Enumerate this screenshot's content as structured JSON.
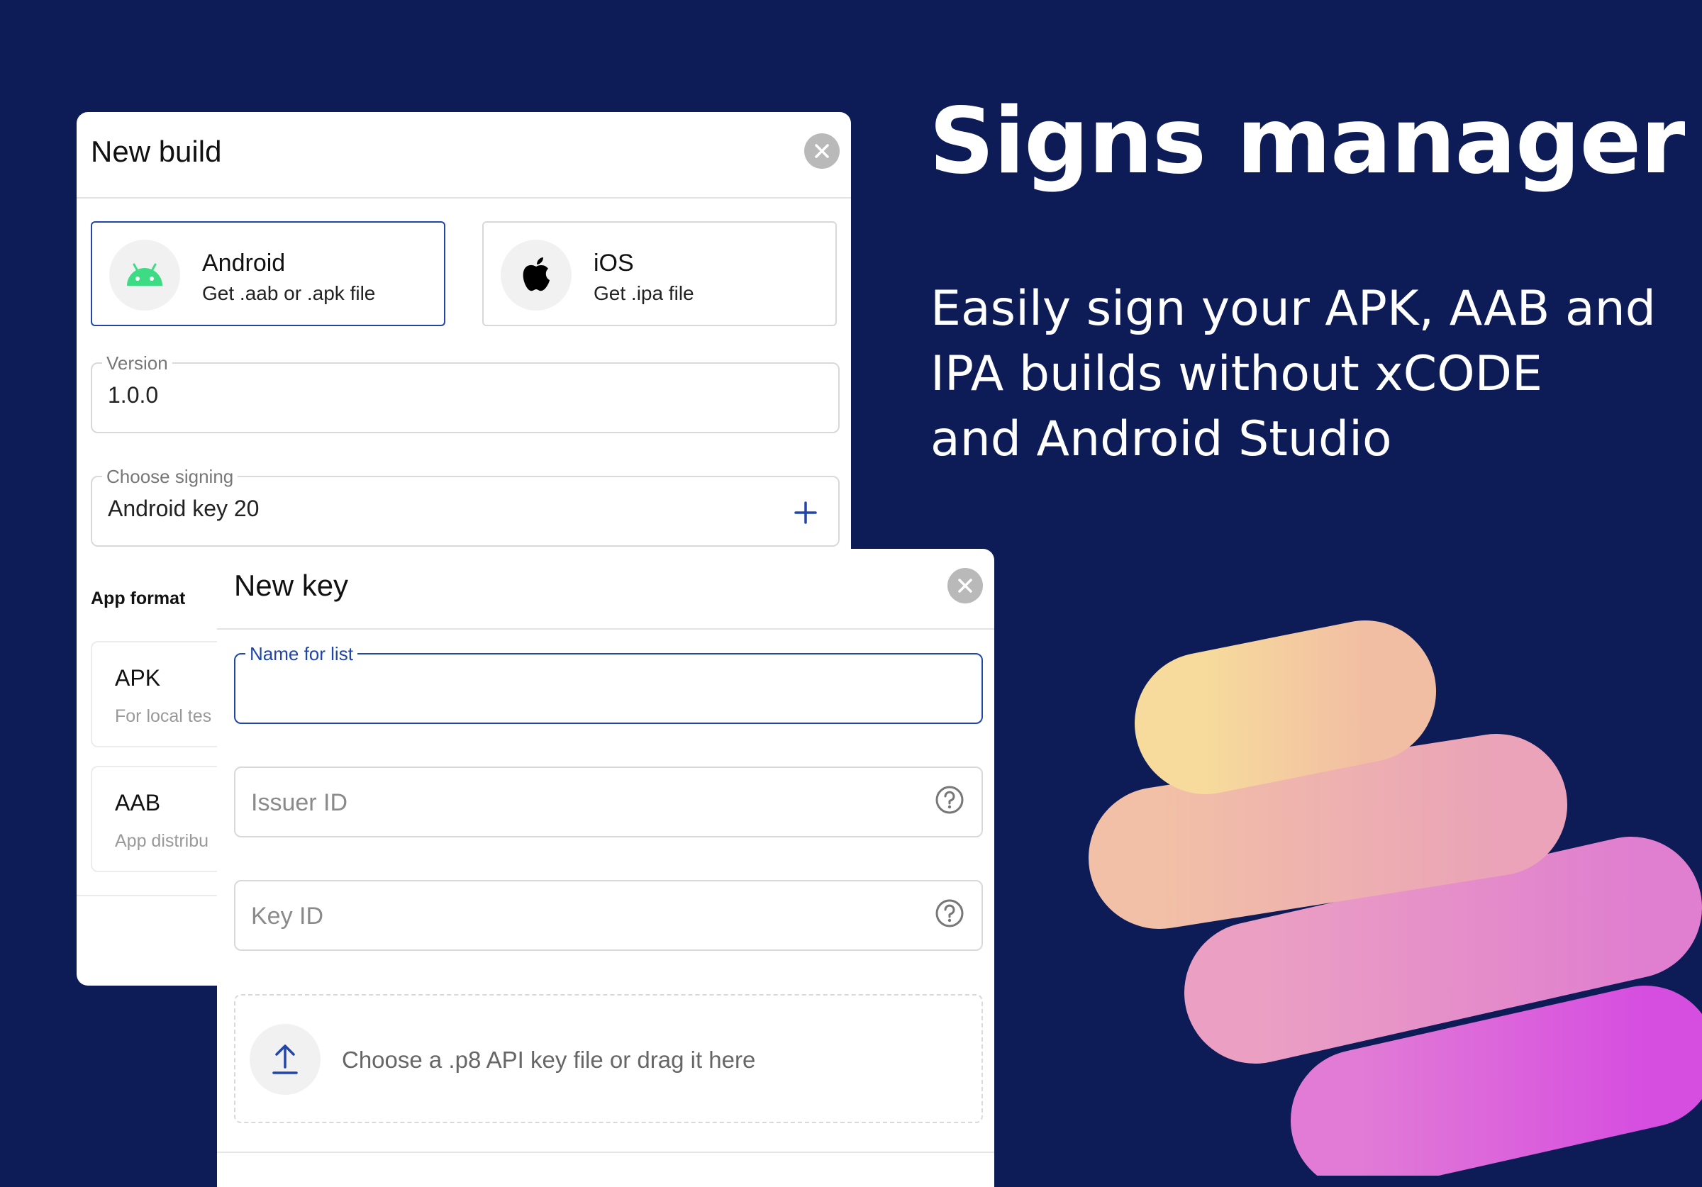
{
  "hero": {
    "title": "Signs manager",
    "subtitle_line1": "Easily sign your APK, AAB and",
    "subtitle_line2": "IPA builds without xCODE",
    "subtitle_line3": "and Android Studio"
  },
  "new_build": {
    "title": "New build",
    "platforms": [
      {
        "name": "Android",
        "desc": "Get .aab or .apk file",
        "icon": "android-icon",
        "selected": true
      },
      {
        "name": "iOS",
        "desc": "Get .ipa file",
        "icon": "apple-icon",
        "selected": false
      }
    ],
    "version": {
      "label": "Version",
      "value": "1.0.0"
    },
    "signing": {
      "label": "Choose signing",
      "value": "Android key 20"
    },
    "app_format_label": "App format",
    "formats": [
      {
        "name": "APK",
        "desc": "For local tes"
      },
      {
        "name": "AAB",
        "desc": "App distribu"
      }
    ]
  },
  "new_key": {
    "title": "New key",
    "name_field": {
      "label": "Name for list",
      "value": ""
    },
    "issuer_field": {
      "placeholder": "Issuer ID"
    },
    "key_field": {
      "placeholder": "Key ID"
    },
    "upload_text": "Choose a .p8 API key file or drag it here"
  },
  "colors": {
    "background": "#0d1b57",
    "accent": "#2145a8",
    "android_green": "#3ddc84"
  }
}
